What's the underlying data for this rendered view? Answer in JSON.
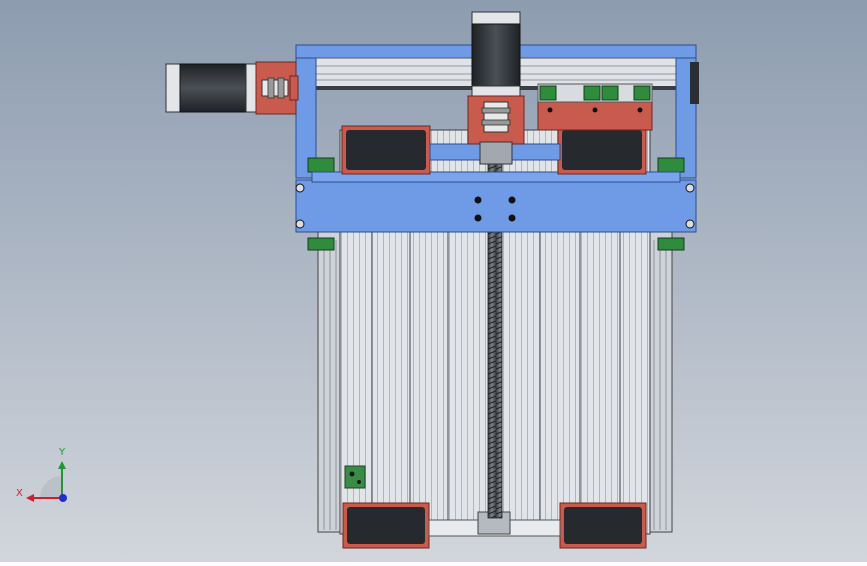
{
  "viewport": {
    "background_top": "#8d9cb0",
    "background_bottom": "#d2d6dc"
  },
  "colors": {
    "frame_blue": "#6f9be6",
    "frame_blue_dark": "#3f64b0",
    "motor_red": "#c65a4e",
    "motor_red_dark": "#8d2f26",
    "rail_silver": "#d9dde3",
    "rail_dark": "#8c9198",
    "pad_black": "#262a2e",
    "rail_green": "#2f8c3c",
    "stepper_dark": "#2c2f33"
  },
  "triad": {
    "x_label": "X",
    "y_label": "Y",
    "x_color": "#d0202a",
    "y_color": "#1d9b2a",
    "z_color": "#2030d0"
  }
}
